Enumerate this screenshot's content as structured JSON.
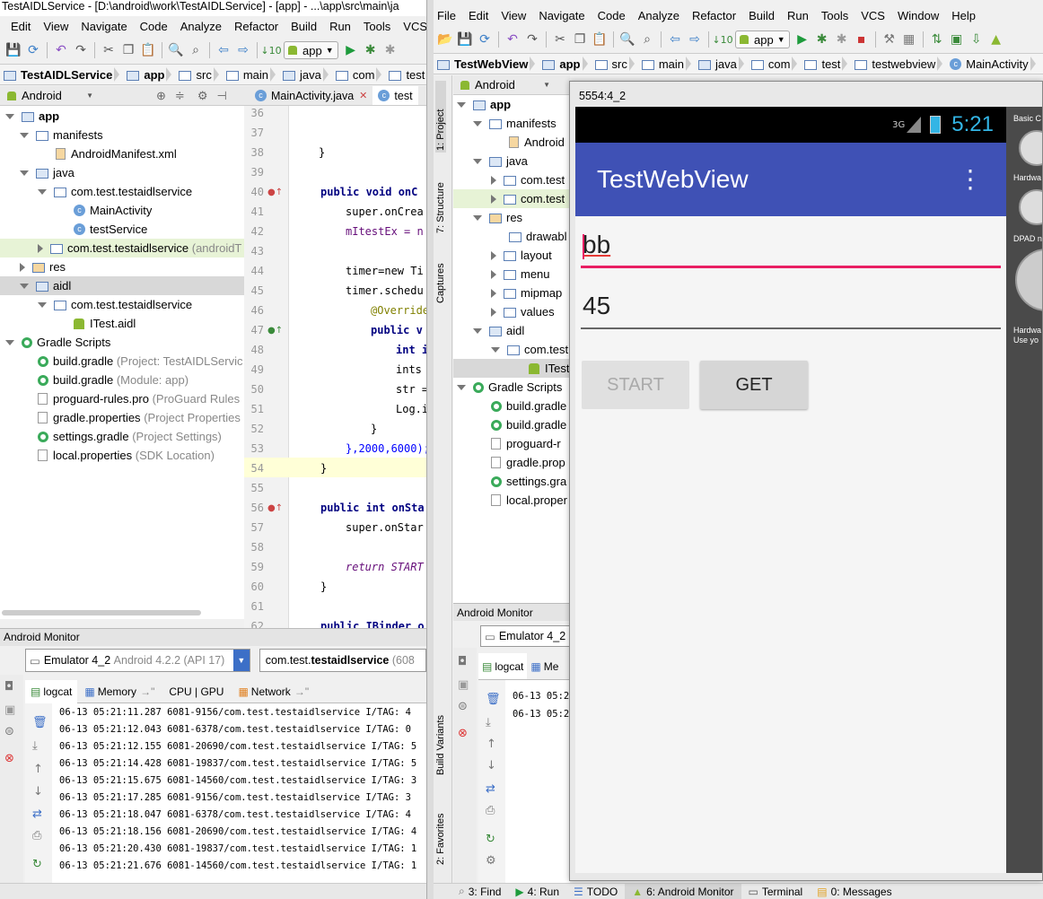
{
  "left": {
    "title": "TestAIDLService - [D:\\android\\work\\TestAIDLService] - [app] - ...\\app\\src\\main\\ja",
    "menu": [
      "Edit",
      "View",
      "Navigate",
      "Code",
      "Analyze",
      "Refactor",
      "Build",
      "Run",
      "Tools",
      "VCS"
    ],
    "run_config": "app",
    "breadcrumbs": [
      "TestAIDLService",
      "app",
      "src",
      "main",
      "java",
      "com",
      "test",
      "te"
    ],
    "view_selector": "Android",
    "editor_tabs": [
      "MainActivity.java",
      "test"
    ],
    "tree": [
      {
        "label": "app",
        "bold": true
      },
      {
        "label": "manifests"
      },
      {
        "label": "AndroidManifest.xml"
      },
      {
        "label": "java"
      },
      {
        "label": "com.test.testaidlservice"
      },
      {
        "label": "MainActivity"
      },
      {
        "label": "testService"
      },
      {
        "label": "com.test.testaidlservice",
        "hint": "(androidT"
      },
      {
        "label": "res"
      },
      {
        "label": "aidl"
      },
      {
        "label": "com.test.testaidlservice"
      },
      {
        "label": "ITest.aidl"
      },
      {
        "label": "Gradle Scripts"
      },
      {
        "label": "build.gradle",
        "hint": "(Project: TestAIDLServic"
      },
      {
        "label": "build.gradle",
        "hint": "(Module: app)"
      },
      {
        "label": "proguard-rules.pro",
        "hint": "(ProGuard Rules"
      },
      {
        "label": "gradle.properties",
        "hint": "(Project Properties"
      },
      {
        "label": "settings.gradle",
        "hint": "(Project Settings)"
      },
      {
        "label": "local.properties",
        "hint": "(SDK Location)"
      }
    ],
    "line_numbers": [
      "36",
      "37",
      "38",
      "39",
      "40",
      "41",
      "42",
      "43",
      "44",
      "45",
      "46",
      "47",
      "48",
      "49",
      "50",
      "51",
      "52",
      "53",
      "54",
      "55",
      "56",
      "57",
      "58",
      "59",
      "60",
      "61",
      "62"
    ],
    "code": [
      "}",
      "public void onC",
      "super.onCrea",
      "mItestEx = n",
      "timer=new Ti",
      "timer.schedu",
      "@Override",
      "public v",
      "int i",
      "ints",
      "str =",
      "Log.i",
      "}",
      "},2000,6000);",
      "}",
      "public int onSta",
      "super.onStar",
      "return START",
      "}",
      "public IBinder o"
    ],
    "monitor_title": "Android Monitor",
    "device": "Emulator 4_2",
    "device_detail": "Android 4.2.2 (API 17)",
    "process_prefix": "com.test.",
    "process_bold": "testaidlservice",
    "process_suffix": "(608",
    "monitor_tabs": [
      "logcat",
      "Memory",
      "CPU | GPU",
      "Network"
    ],
    "logs": [
      "06-13 05:21:11.287 6081-9156/com.test.testaidlservice I/TAG: 4",
      "06-13 05:21:12.043 6081-6378/com.test.testaidlservice I/TAG: 0",
      "06-13 05:21:12.155 6081-20690/com.test.testaidlservice I/TAG: 5",
      "06-13 05:21:14.428 6081-19837/com.test.testaidlservice I/TAG: 5",
      "06-13 05:21:15.675 6081-14560/com.test.testaidlservice I/TAG: 3",
      "06-13 05:21:17.285 6081-9156/com.test.testaidlservice I/TAG: 3",
      "06-13 05:21:18.047 6081-6378/com.test.testaidlservice I/TAG: 4",
      "06-13 05:21:18.156 6081-20690/com.test.testaidlservice I/TAG: 4",
      "06-13 05:21:20.430 6081-19837/com.test.testaidlservice I/TAG: 1",
      "06-13 05:21:21.676 6081-14560/com.test.testaidlservice I/TAG: 1"
    ]
  },
  "right": {
    "menu": [
      "File",
      "Edit",
      "View",
      "Navigate",
      "Code",
      "Analyze",
      "Refactor",
      "Build",
      "Run",
      "Tools",
      "VCS",
      "Window",
      "Help"
    ],
    "run_config": "app",
    "breadcrumbs": [
      "TestWebView",
      "app",
      "src",
      "main",
      "java",
      "com",
      "test",
      "testwebview",
      "MainActivity"
    ],
    "view_selector": "Android",
    "side_tabs": [
      "1: Project",
      "7: Structure",
      "Captures",
      "Build Variants",
      "2: Favorites"
    ],
    "tree": [
      {
        "label": "app"
      },
      {
        "label": "manifests"
      },
      {
        "label": "Android"
      },
      {
        "label": "java"
      },
      {
        "label": "com.test"
      },
      {
        "label": "com.test"
      },
      {
        "label": "res"
      },
      {
        "label": "drawabl"
      },
      {
        "label": "layout"
      },
      {
        "label": "menu"
      },
      {
        "label": "mipmap"
      },
      {
        "label": "values"
      },
      {
        "label": "aidl"
      },
      {
        "label": "com.test"
      },
      {
        "label": "ITest"
      },
      {
        "label": "Gradle Scripts"
      },
      {
        "label": "build.gradle"
      },
      {
        "label": "build.gradle"
      },
      {
        "label": "proguard-r"
      },
      {
        "label": "gradle.prop"
      },
      {
        "label": "settings.gra"
      },
      {
        "label": "local.proper"
      }
    ],
    "monitor_title": "Android Monitor",
    "device": "Emulator 4_2",
    "monitor_tabs": [
      "logcat",
      "Me"
    ],
    "logs": [
      "06-13 05:2",
      "06-13 05:2"
    ],
    "bottom_tabs": [
      "3: Find",
      "4: Run",
      "TODO",
      "6: Android Monitor",
      "Terminal",
      "0: Messages"
    ]
  },
  "emulator": {
    "title": "5554:4_2",
    "network": "3G",
    "time": "5:21",
    "app_title": "TestWebView",
    "field1": "bb",
    "field2": "45",
    "start_button": "START",
    "get_button": "GET",
    "side_labels": [
      "Basic C",
      "Hardwa",
      "DPAD n",
      "Hardwa",
      "Use yo"
    ],
    "accent": "#3f51b5",
    "status_bar": "#000000",
    "input_focus": "#e91e63"
  }
}
